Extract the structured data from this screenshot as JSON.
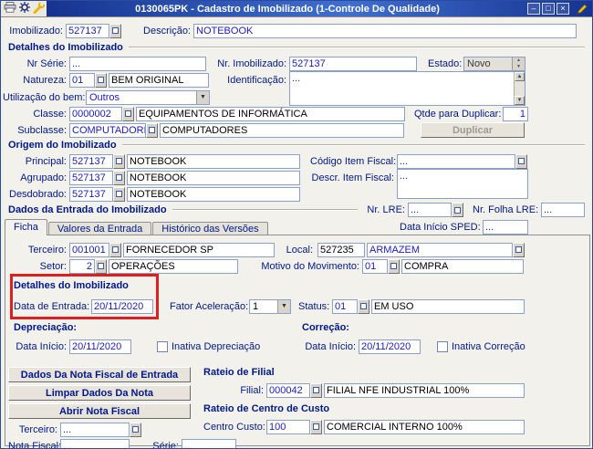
{
  "colors": {
    "accent": "#00188c",
    "value_text": "#1a1ac8",
    "annotation": "#de1f1f",
    "titlebar": "#16338f"
  },
  "window": {
    "title": "0130065PK - Cadastro de Imobilizado (1-Controle De Qualidade)",
    "minimize_glyph": "–",
    "maximize_glyph": "□",
    "close_glyph": "×"
  },
  "top": {
    "imobilizado": {
      "label": "Imobilizado:",
      "value": "527137"
    },
    "descricao": {
      "label": "Descrição:",
      "value": "NOTEBOOK"
    }
  },
  "detalhes": {
    "title": "Detalhes do Imobilizado",
    "nr_serie": {
      "label": "Nr Série:",
      "value": "..."
    },
    "nr_imobilizado": {
      "label": "Nr. Imobilizado:",
      "value": "527137"
    },
    "estado": {
      "label": "Estado:",
      "value": "Novo"
    },
    "natureza": {
      "label": "Natureza:",
      "value": "01",
      "desc": "BEM ORIGINAL"
    },
    "identificacao": {
      "label": "Identificação:",
      "value": "..."
    },
    "utilizacao": {
      "label": "Utilização do bem:",
      "value": "Outros"
    },
    "classe": {
      "label": "Classe:",
      "value": "0000002",
      "desc": "EQUIPAMENTOS DE INFORMÁTICA"
    },
    "qtde_duplicar": {
      "label": "Qtde para Duplicar:",
      "value": "1"
    },
    "subclasse": {
      "label": "Subclasse:",
      "value": "COMPUTADORES",
      "desc": "COMPUTADORES"
    },
    "duplicar_button": "Duplicar"
  },
  "origem": {
    "title": "Origem do Imobilizado",
    "principal": {
      "label": "Principal:",
      "value": "527137",
      "desc": "NOTEBOOK"
    },
    "agrupado": {
      "label": "Agrupado:",
      "value": "527137",
      "desc": "NOTEBOOK"
    },
    "desdobrado": {
      "label": "Desdobrado:",
      "value": "527137",
      "desc": "NOTEBOOK"
    },
    "cod_item_fiscal": {
      "label": "Código Item Fiscal:",
      "value": "..."
    },
    "descr_item_fiscal": {
      "label": "Descr. Item Fiscal:",
      "value": "..."
    }
  },
  "entrada": {
    "title": "Dados da Entrada do Imobilizado",
    "nr_lre": {
      "label": "Nr. LRE:",
      "value": "..."
    },
    "nr_folha_lre": {
      "label": "Nr. Folha LRE:",
      "value": "..."
    }
  },
  "tabs": {
    "items": [
      {
        "label": "Ficha"
      },
      {
        "label": "Valores da Entrada"
      },
      {
        "label": "Histórico das Versões"
      }
    ],
    "data_inicio_sped": {
      "label": "Data Início SPED:",
      "value": "..."
    }
  },
  "ficha": {
    "terceiro": {
      "label": "Terceiro:",
      "value": "001001",
      "desc": "FORNECEDOR SP"
    },
    "local": {
      "label": "Local:",
      "value": "527235",
      "desc": "ARMAZEM"
    },
    "setor": {
      "label": "Setor:",
      "value": "2",
      "desc": "OPERAÇÕES"
    },
    "motivo": {
      "label": "Motivo do Movimento:",
      "value": "01",
      "desc": "COMPRA"
    },
    "detalhes_title": "Detalhes do Imobilizado",
    "data_entrada": {
      "label": "Data de Entrada:",
      "value": "20/11/2020"
    },
    "fator": {
      "label": "Fator Aceleração:",
      "value": "1"
    },
    "status": {
      "label": "Status:",
      "value": "01",
      "desc": "EM USO"
    },
    "depreciacao_title": "Depreciação:",
    "correcao_title": "Correção:",
    "dep_data_inicio": {
      "label": "Data Início:",
      "value": "20/11/2020"
    },
    "dep_inativa_label": "Inativa Depreciação",
    "cor_data_inicio": {
      "label": "Data Início:",
      "value": "20/11/2020"
    },
    "cor_inativa_label": "Inativa Correção",
    "buttons": [
      "Dados Da Nota Fiscal de Entrada",
      "Limpar Dados Da Nota",
      "Abrir Nota Fiscal"
    ],
    "rateio_filial_title": "Rateio de Filial",
    "filial": {
      "label": "Filial:",
      "value": "000042",
      "desc": "FILIAL NFE INDUSTRIAL 100%"
    },
    "rateio_cc_title": "Rateio de Centro de Custo",
    "centro_custo": {
      "label": "Centro Custo:",
      "value": "100",
      "desc": "COMERCIAL INTERNO 100%"
    },
    "terceiro_nf": {
      "label": "Terceiro:",
      "value": "..."
    },
    "nota_fiscal": {
      "label": "Nota Fiscal:",
      "value": "..."
    },
    "serie": {
      "label": "Série:",
      "value": "..."
    }
  }
}
